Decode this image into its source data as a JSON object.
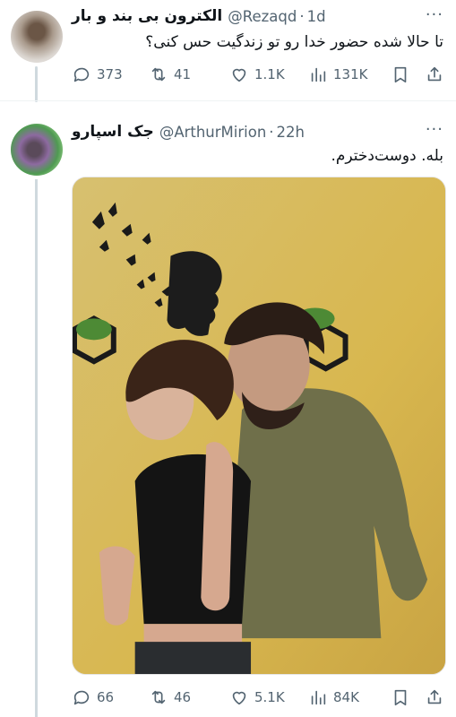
{
  "tweet1": {
    "name": "الکترون بی بند و بار",
    "handle": "@Rezaqd",
    "time": "1d",
    "text": "تا حالا شده حضور خدا رو تو زندگیت حس کنی؟",
    "reply_count": "373",
    "retweet_count": "41",
    "like_count": "1.1K",
    "view_count": "131K"
  },
  "tweet2": {
    "name": "جک اسپارو",
    "handle": "@ArthurMirion",
    "time": "22h",
    "text": "بله. دوست‌دخترم.",
    "reply_count": "66",
    "retweet_count": "46",
    "like_count": "5.1K",
    "view_count": "84K"
  },
  "ui": {
    "more_glyph": "···",
    "dot_separator": "·"
  },
  "colors": {
    "text_primary": "#0f1419",
    "text_secondary": "#536471",
    "thread_line": "#cfd9de",
    "photo_wall": "#d9b85a"
  },
  "icons": [
    "reply-icon",
    "retweet-icon",
    "like-icon",
    "views-icon",
    "bookmark-icon",
    "share-icon",
    "more-icon"
  ]
}
